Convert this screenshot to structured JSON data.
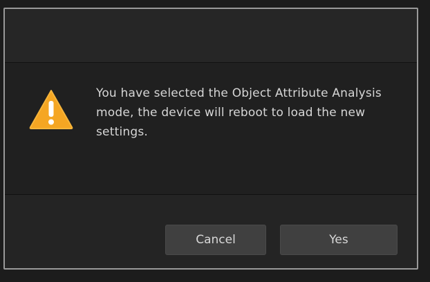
{
  "dialog": {
    "icon": "warning-icon",
    "message": "You have selected the Object Attribute Analysis mode, the device will reboot to load the new settings.",
    "buttons": {
      "cancel_label": "Cancel",
      "yes_label": "Yes"
    }
  },
  "colors": {
    "icon_fill": "#f5a623",
    "icon_mark": "#ffffff"
  }
}
